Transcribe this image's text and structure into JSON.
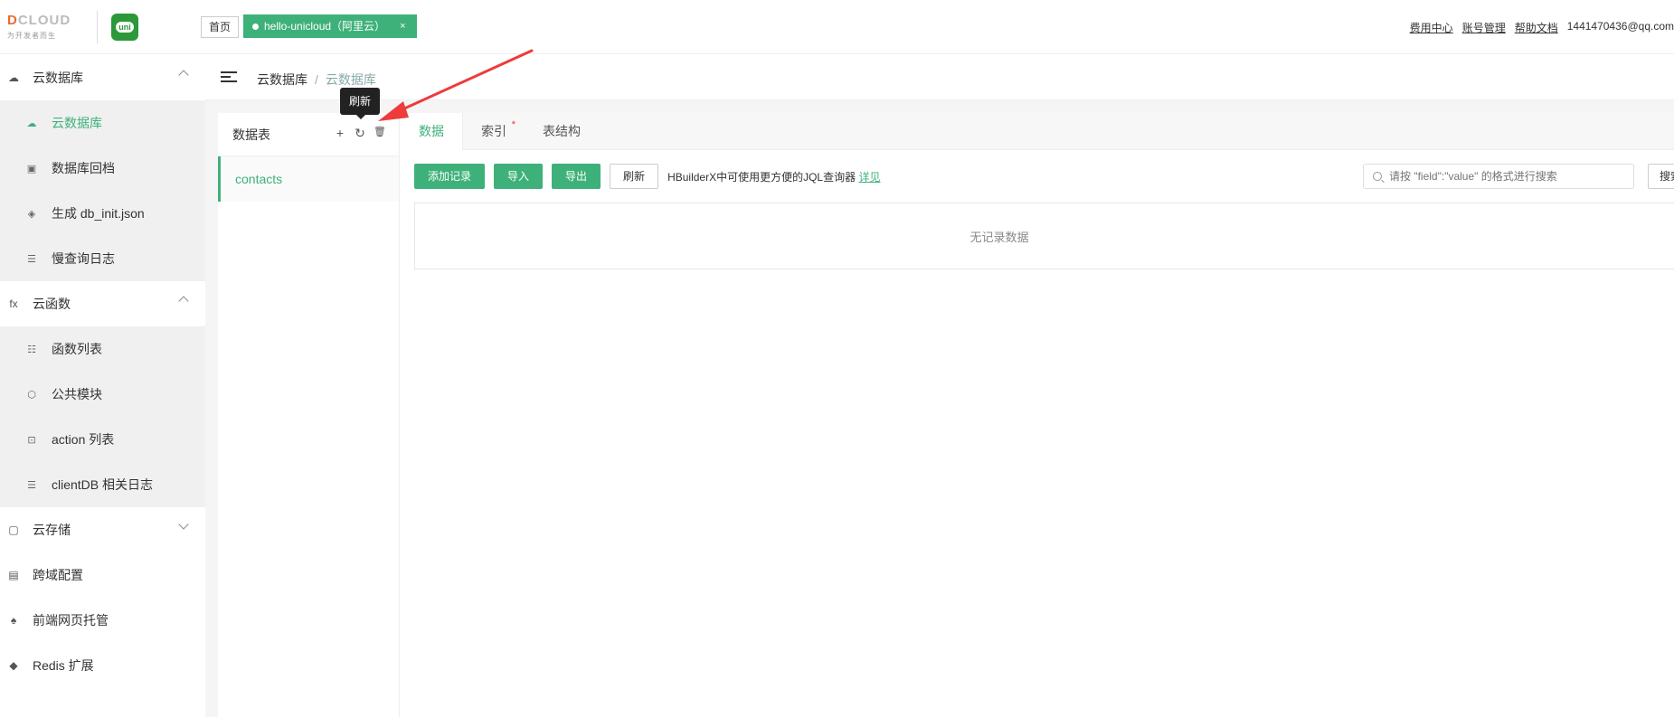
{
  "header": {
    "logo_text": "DCLOUD",
    "logo_sub": "为开发者而生",
    "uni_logo": "uni",
    "home_tab": "首页",
    "space_tab": "hello-unicloud（阿里云）",
    "space_tab_close": "×",
    "links": [
      "费用中心",
      "账号管理",
      "帮助文档"
    ],
    "user": "1441470436@qq.com"
  },
  "sidebar": {
    "groups": [
      {
        "title": "云数据库",
        "icon": "database-icon",
        "expanded": true,
        "items": [
          {
            "label": "云数据库",
            "icon": "database-icon",
            "active": true
          },
          {
            "label": "数据库回档",
            "icon": "rollback-icon"
          },
          {
            "label": "生成 db_init.json",
            "icon": "generate-icon"
          },
          {
            "label": "慢查询日志",
            "icon": "log-icon"
          }
        ]
      },
      {
        "title": "云函数",
        "icon": "fx-icon",
        "glyph": "fx",
        "expanded": true,
        "items": [
          {
            "label": "函数列表",
            "icon": "list-icon"
          },
          {
            "label": "公共模块",
            "icon": "cube-icon"
          },
          {
            "label": "action 列表",
            "icon": "action-icon"
          },
          {
            "label": "clientDB 相关日志",
            "icon": "log-icon"
          }
        ]
      },
      {
        "title": "云存储",
        "icon": "storage-icon",
        "expanded": false
      },
      {
        "title": "跨域配置",
        "icon": "cors-icon"
      },
      {
        "title": "前端网页托管",
        "icon": "hosting-icon"
      },
      {
        "title": "Redis 扩展",
        "icon": "redis-icon"
      }
    ]
  },
  "breadcrumb": {
    "root": "云数据库",
    "sep": "/",
    "current": "云数据库"
  },
  "table_list": {
    "title": "数据表",
    "add_icon": "+",
    "refresh_icon": "↻",
    "delete_icon": "🗑",
    "tables": [
      "contacts"
    ]
  },
  "tooltip": "刷新",
  "tabs": [
    {
      "label": "数据",
      "active": true
    },
    {
      "label": "索引",
      "star": "*"
    },
    {
      "label": "表结构"
    }
  ],
  "toolbar": {
    "add_record": "添加记录",
    "import": "导入",
    "export": "导出",
    "refresh": "刷新",
    "hint": "HBuilderX中可使用更方便的JQL查询器",
    "hint_link": "详见"
  },
  "search": {
    "placeholder": "请按 \"field\":\"value\" 的格式进行搜索",
    "button": "搜索"
  },
  "empty_text": "无记录数据",
  "colors": {
    "accent": "#3eb17a",
    "arrow": "#ee3b3b"
  }
}
